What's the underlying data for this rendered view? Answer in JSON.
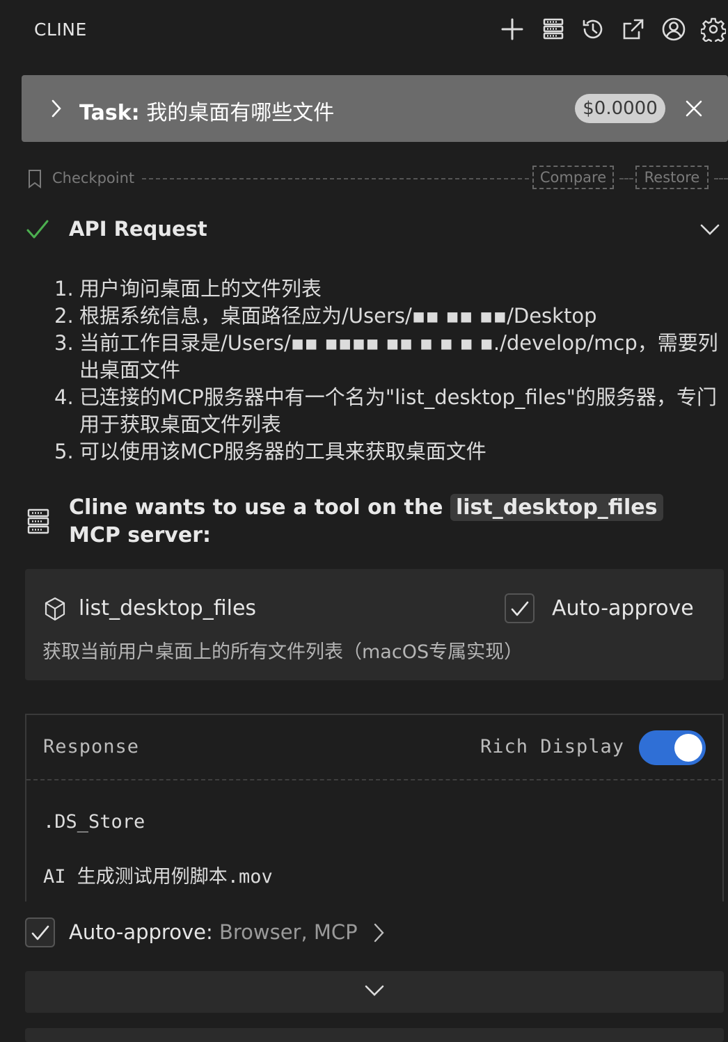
{
  "app": {
    "title": "CLINE"
  },
  "header": {
    "icons": [
      "plus-icon",
      "server-icon",
      "history-icon",
      "external-link-icon",
      "account-icon",
      "gear-icon"
    ]
  },
  "task": {
    "prefix": "Task:",
    "text": "我的桌面有哪些文件",
    "cost": "$0.0000"
  },
  "checkpoint": {
    "label": "Checkpoint",
    "compare": "Compare",
    "restore": "Restore"
  },
  "api_request": {
    "title": "API Request",
    "steps": [
      {
        "num": "1.",
        "text": "用户询问桌面上的文件列表"
      },
      {
        "num": "2.",
        "text": "根据系统信息，桌面路径应为/Users/▪▪ ▪▪ ▪▪/Desktop"
      },
      {
        "num": "3.",
        "text": "当前工作目录是/Users/▪▪ ▪▪▪▪ ▪▪ ▪ ▪ ▪ ▪./develop/mcp，需要列出桌面文件"
      },
      {
        "num": "4.",
        "text": "已连接的MCP服务器中有一个名为\"list_desktop_files\"的服务器，专门用于获取桌面文件列表"
      },
      {
        "num": "5.",
        "text": "可以使用该MCP服务器的工具来获取桌面文件"
      }
    ]
  },
  "tool_use": {
    "heading_before": "Cline wants to use a tool on the ",
    "server_name": "list_desktop_files",
    "heading_after": " MCP server:",
    "tool_name": "list_desktop_files",
    "auto_approve_label": "Auto-approve",
    "auto_approve_checked": true,
    "description": "获取当前用户桌面上的所有文件列表（macOS专属实现）"
  },
  "response": {
    "title": "Response",
    "rich_display_label": "Rich Display",
    "rich_display_on": true,
    "lines": [
      ".DS_Store",
      "AI 生成测试用例脚本.mov"
    ]
  },
  "footer": {
    "auto_approve_label": "Auto-approve:",
    "auto_approve_value": " Browser, MCP",
    "auto_approve_checked": true
  },
  "colors": {
    "background": "#1e1e1e",
    "task_bar": "#6b6b6b",
    "card": "#2b2b2b",
    "toggle_on": "#2f6fd6",
    "success_check": "#4caf50"
  }
}
